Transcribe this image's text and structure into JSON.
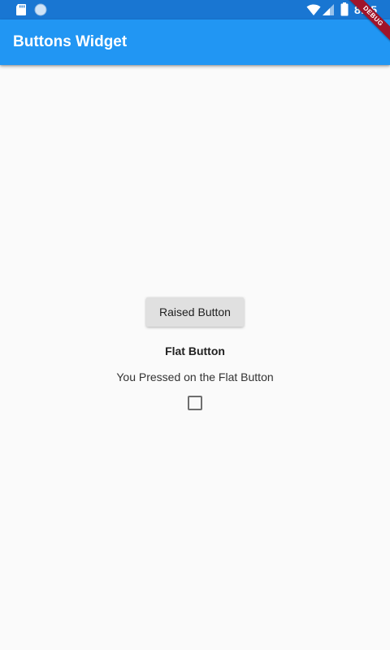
{
  "status_bar": {
    "time": "8:25",
    "left_icons": [
      "sd-card-icon",
      "circle-icon"
    ],
    "right_icons": [
      "wifi-icon",
      "signal-icon",
      "battery-icon"
    ],
    "color": "#1976d2"
  },
  "app_bar": {
    "title": "Buttons Widget",
    "color": "#2196f3"
  },
  "debug_banner": {
    "label": "DEBUG"
  },
  "content": {
    "raised_button_label": "Raised Button",
    "flat_button_label": "Flat Button",
    "message": "You Pressed on the Flat Button",
    "checkbox_checked": false
  }
}
